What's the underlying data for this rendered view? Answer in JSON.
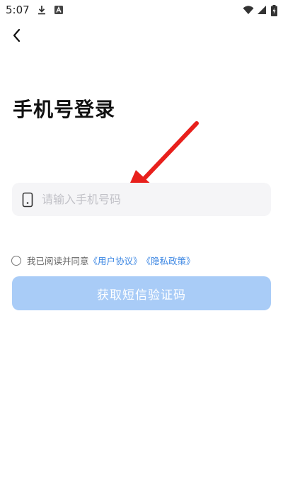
{
  "status_bar": {
    "time": "5:07",
    "icons": [
      "download-icon",
      "notification-a-icon",
      "wifi-icon",
      "cellular-signal-icon",
      "battery-icon"
    ]
  },
  "nav": {
    "back_icon": "chevron-left-icon"
  },
  "page": {
    "title": "手机号登录"
  },
  "phone_input": {
    "icon": "phone-icon",
    "placeholder": "请输入手机号码",
    "value": ""
  },
  "agreement": {
    "prefix": "我已阅读并同意",
    "user_agreement_link": "《用户协议》",
    "privacy_policy_link": "《隐私政策》",
    "checked": false
  },
  "actions": {
    "get_code_label": "获取短信验证码",
    "enabled": false
  },
  "colors": {
    "accent_link": "#3b86e3",
    "button_disabled": "#a9ccf7",
    "annotation_arrow": "#e8201c",
    "input_bg": "#f5f5f7"
  }
}
